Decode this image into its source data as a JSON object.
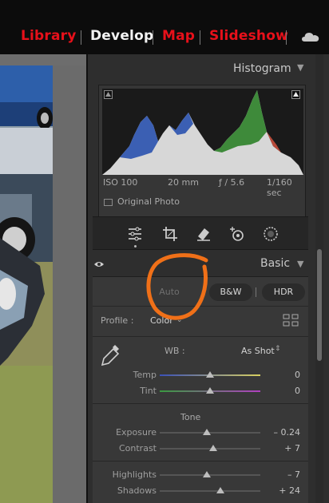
{
  "modules": {
    "library": "Library",
    "develop": "Develop",
    "map": "Map",
    "slideshow": "Slideshow"
  },
  "colors": {
    "module_inactive": "#e8101a",
    "module_active": "#f2f2f2",
    "annotation_circle": "#f07018"
  },
  "histogram": {
    "title": "Histogram",
    "iso": "ISO 100",
    "focal": "20 mm",
    "aperture": "ƒ / 5.6",
    "shutter": "1/160 sec",
    "original_photo": "Original Photo"
  },
  "tools": [
    "sliders-icon",
    "crop-icon",
    "eraser-icon",
    "redeye-icon",
    "mask-icon"
  ],
  "basic": {
    "title": "Basic",
    "auto": "Auto",
    "bw": "B&W",
    "hdr": "HDR",
    "profile_label": "Profile :",
    "profile_value": "Color",
    "wb_label": "WB :",
    "wb_value": "As Shot",
    "tone_label": "Tone",
    "sliders": [
      {
        "label": "Temp",
        "value": "0",
        "level": 0.5
      },
      {
        "label": "Tint",
        "value": "0",
        "level": 0.5
      },
      {
        "label": "Exposure",
        "value": "– 0.24",
        "level": 0.47
      },
      {
        "label": "Contrast",
        "value": "+ 7",
        "level": 0.53
      },
      {
        "label": "Highlights",
        "value": "– 7",
        "level": 0.47
      },
      {
        "label": "Shadows",
        "value": "+ 24",
        "level": 0.6
      }
    ]
  }
}
